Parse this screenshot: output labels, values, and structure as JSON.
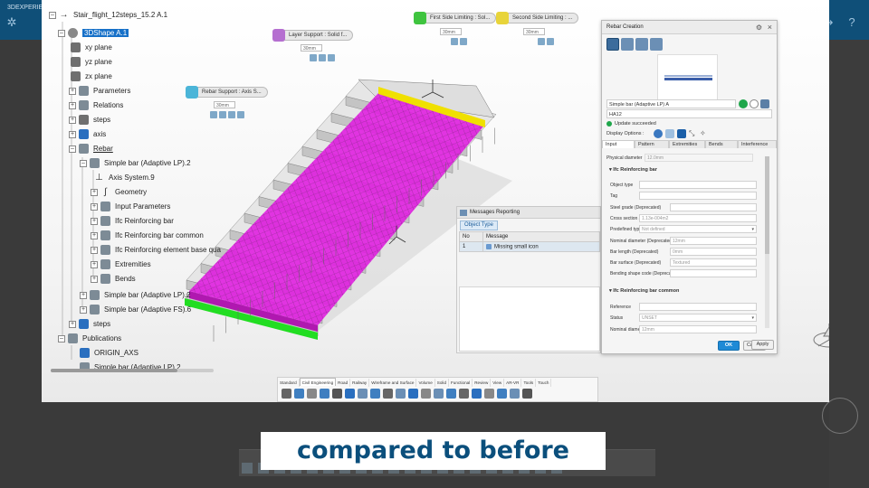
{
  "outer_app": {
    "tab_label": "3DEXPERIEN"
  },
  "tree": {
    "items": [
      {
        "label": "Stair_flight_12steps_15.2 A.1"
      },
      {
        "label": "3DShape A.1"
      },
      {
        "label": "xy plane"
      },
      {
        "label": "yz plane"
      },
      {
        "label": "zx plane"
      },
      {
        "label": "Parameters"
      },
      {
        "label": "Relations"
      },
      {
        "label": "steps"
      },
      {
        "label": "axis"
      },
      {
        "label": "Rebar"
      },
      {
        "label": "Simple bar (Adaptive LP).2"
      },
      {
        "label": "Axis System.9"
      },
      {
        "label": "Geometry"
      },
      {
        "label": "Input Parameters"
      },
      {
        "label": "Ifc Reinforcing bar"
      },
      {
        "label": "Ifc Reinforcing bar common"
      },
      {
        "label": "Ifc Reinforcing element base qua"
      },
      {
        "label": "Extremities"
      },
      {
        "label": "Bends"
      },
      {
        "label": "Simple bar (Adaptive LP).2"
      },
      {
        "label": "Simple bar (Adaptive FS).6"
      },
      {
        "label": "steps"
      },
      {
        "label": "Publications"
      },
      {
        "label": "ORIGIN_AXS"
      },
      {
        "label": "Simple bar (Adaptive LP).2"
      }
    ]
  },
  "viewport_labels": {
    "layer_support": "Layer Support : Solid f...",
    "rebar_support": "Rebar Support : Axis S...",
    "first_side": "First Side Limiting : Sol...",
    "second_side": "Second Side Limiting : ...",
    "val_layer": "30mm",
    "val_rebar": "30mm",
    "val_first": "30mm",
    "val_second": "30mm"
  },
  "messages": {
    "title": "Messages Reporting",
    "object_type": "Object Type",
    "col_no": "No",
    "col_message": "Message",
    "rows": [
      {
        "no": "1",
        "message": "Missing small icon"
      }
    ]
  },
  "rebar_dialog": {
    "title": "Rebar Creation",
    "bar_name": "Simple bar (Adaptive LP) A",
    "material": "HA12",
    "status": "Update succeeded",
    "display_options": "Display Options :",
    "tabs": [
      "Input",
      "Pattern",
      "Extremities",
      "Bends",
      "Interference"
    ],
    "physical_diameter_label": "Physical diameter",
    "physical_diameter_value": "12.0mm",
    "section_1": "Ifc Reinforcing bar",
    "fields_1": [
      {
        "label": "Object type",
        "value": ""
      },
      {
        "label": "Tag",
        "value": ""
      },
      {
        "label": "Steel grade (Deprecated)",
        "value": ""
      },
      {
        "label": "Cross section area",
        "value": "1.13e-004m2"
      },
      {
        "label": "Predefined type",
        "value": "Not defined"
      },
      {
        "label": "Nominal diameter (Deprecated)",
        "value": "12mm"
      },
      {
        "label": "Bar length (Deprecated)",
        "value": "0mm"
      },
      {
        "label": "Bar surface (Deprecated)",
        "value": "Textured"
      },
      {
        "label": "Bending shape code (Deprecated)",
        "value": ""
      }
    ],
    "section_2": "Ifc Reinforcing bar common",
    "fields_2": [
      {
        "label": "Reference",
        "value": ""
      },
      {
        "label": "Status",
        "value": "UNSET"
      },
      {
        "label": "Nominal diameter",
        "value": "12mm"
      }
    ],
    "ok": "OK",
    "cancel": "Cancel",
    "apply": "Apply"
  },
  "action_bar": {
    "tabs": [
      "Standard",
      "Civil Engineering",
      "Road",
      "Railway",
      "Wireframe and Surface",
      "Volume",
      "Solid",
      "Functional",
      "Review",
      "View",
      "AR-VR",
      "Tools",
      "Touch"
    ]
  },
  "compass": {
    "x_label": "x",
    "z_label": "z"
  },
  "caption": {
    "text": "compared to before"
  },
  "colors": {
    "outer_bar": "#0f4f78",
    "selection": "#1670c8",
    "rebar_magenta": "#e020e0",
    "rebar_yellow": "#f0e000",
    "rebar_green": "#22dd22",
    "caption_text": "#0b4f7c",
    "ok_button": "#1e8ad6"
  },
  "icons": {
    "outer_left": [
      "3ds-compass-icon"
    ],
    "outer_right": [
      "share-icon",
      "forward-icon",
      "help-icon"
    ]
  }
}
